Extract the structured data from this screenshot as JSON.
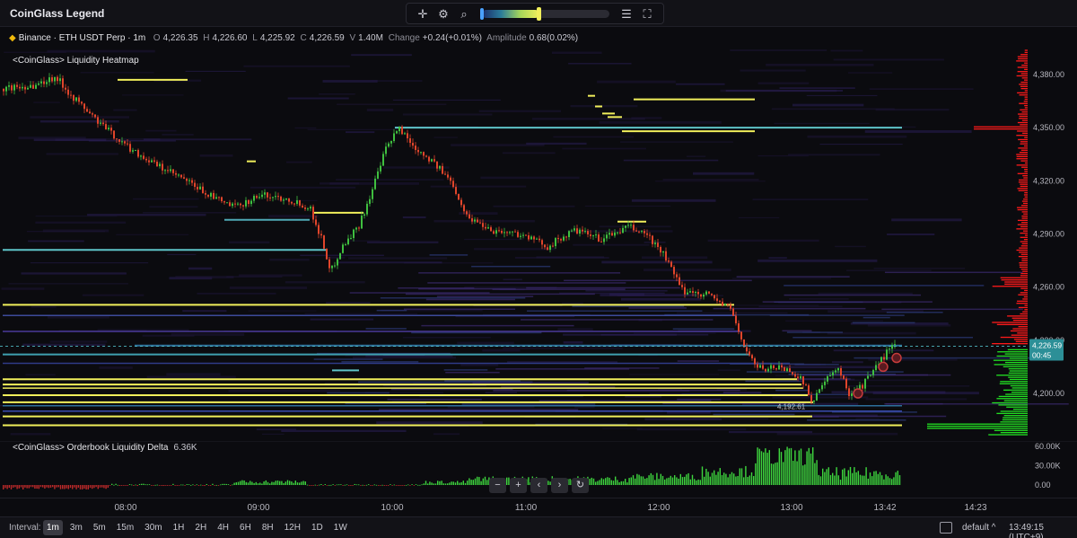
{
  "app": {
    "brand": "CoinGlass Legend"
  },
  "toolbar": {
    "icons": [
      "crosshair-icon",
      "settings-icon",
      "search-icon",
      "filter-icon",
      "screenshot-icon"
    ],
    "heat_level": 0.45
  },
  "symbol": {
    "pair": "Binance · ETH USDT Perp · 1m",
    "o_label": "O",
    "o": "4,226.35",
    "h_label": "H",
    "h": "4,226.60",
    "l_label": "L",
    "l": "4,225.92",
    "c_label": "C",
    "c": "4,226.59",
    "v_label": "V",
    "v": "1.40M",
    "change_label": "Change",
    "change": "+0.24(+0.01%)",
    "amp_label": "Amplitude",
    "amp": "0.68(0.02%)"
  },
  "heatmap": {
    "title": "<CoinGlass> Liquidity Heatmap"
  },
  "price_axis": {
    "labels": [
      "4,380.00",
      "4,350.00",
      "4,320.00",
      "4,290.00",
      "4,260.00",
      "4,230.00",
      "4,200.00"
    ],
    "current_price": "4,226.59",
    "countdown": "00:45",
    "low_marker": "4,192.61"
  },
  "delta": {
    "title": "<CoinGlass> Orderbook Liquidity Delta",
    "value": "6.36K",
    "axis_labels": [
      "60.00K",
      "30.00K",
      "0.00"
    ]
  },
  "time_axis": {
    "labels": [
      "08:00",
      "09:00",
      "10:00",
      "11:00",
      "12:00",
      "13:00",
      "13:42",
      "14:23"
    ]
  },
  "nav_buttons": [
    "−",
    "+",
    "‹",
    "›",
    "↻"
  ],
  "bottom": {
    "interval_label": "Interval:",
    "intervals": [
      "1m",
      "3m",
      "5m",
      "15m",
      "30m",
      "1H",
      "2H",
      "4H",
      "6H",
      "8H",
      "12H",
      "1D",
      "1W"
    ],
    "active_interval": "1m",
    "layout_select": "default ^",
    "clock": "13:49:15 (UTC+9)"
  },
  "colors": {
    "up": "#3fbf3f",
    "down": "#e0452b",
    "heat_yellow": "#f1ef5b",
    "heat_cyan": "#5ec4c8",
    "ask": "#ff1a1a",
    "bid": "#22e022"
  }
}
